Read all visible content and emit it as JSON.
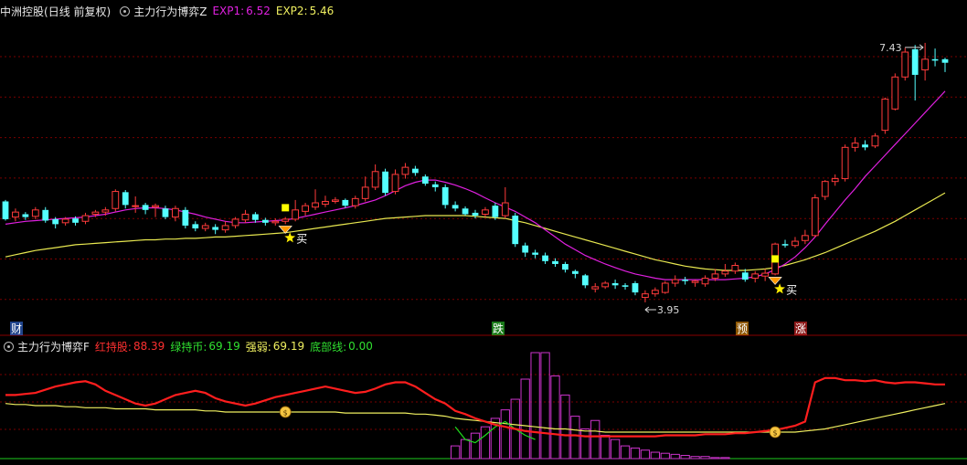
{
  "main_header": {
    "stock": "中洲控股",
    "period": "(日线 前复权)",
    "indicator": "主力行为博弈Z",
    "exp1_label": "EXP1:",
    "exp1_value": "6.52",
    "exp2_label": "EXP2:",
    "exp2_value": "5.46"
  },
  "sub_header": {
    "indicator": "主力行为博弈F",
    "hongchi_label": "红持股:",
    "hongchi_value": "88.39",
    "lvchi_label": "绿持币:",
    "lvchi_value": "69.19",
    "qiangruo_label": "强弱:",
    "qiangruo_value": "69.19",
    "dibu_label": "底部线:",
    "dibu_value": "0.00"
  },
  "colors": {
    "up": "#ff3b3b",
    "down": "#54ffff",
    "ma_fast": "#e020e0",
    "ma_slow": "#e8e850",
    "grid": "#7a0000",
    "hold": "#ff1e1e",
    "cash": "#1edc1e",
    "strength": "#f0f060",
    "bar": "#cc33cc"
  },
  "chart_data": [
    {
      "type": "candlestick",
      "ylim": [
        3.6,
        7.75
      ],
      "grid": true,
      "candles": [
        [
          5.2,
          4.95,
          5.22,
          4.93
        ],
        [
          4.98,
          5.05,
          5.1,
          4.92
        ],
        [
          5.02,
          4.98,
          5.05,
          4.94
        ],
        [
          4.99,
          5.08,
          5.12,
          4.95
        ],
        [
          5.08,
          4.93,
          5.12,
          4.9
        ],
        [
          4.95,
          4.88,
          4.98,
          4.82
        ],
        [
          4.9,
          4.95,
          4.98,
          4.86
        ],
        [
          4.96,
          4.9,
          4.99,
          4.86
        ],
        [
          4.92,
          5.0,
          5.04,
          4.88
        ],
        [
          5.02,
          5.05,
          5.08,
          4.98
        ],
        [
          5.05,
          5.08,
          5.12,
          5.0
        ],
        [
          5.1,
          5.34,
          5.37,
          5.06
        ],
        [
          5.33,
          5.15,
          5.36,
          5.1
        ],
        [
          5.14,
          5.14,
          5.27,
          5.04
        ],
        [
          5.15,
          5.08,
          5.18,
          5.02
        ],
        [
          5.12,
          5.14,
          5.17,
          4.98
        ],
        [
          5.1,
          4.98,
          5.14,
          4.95
        ],
        [
          4.98,
          5.1,
          5.14,
          4.92
        ],
        [
          5.08,
          4.86,
          5.12,
          4.82
        ],
        [
          4.88,
          4.82,
          4.92,
          4.78
        ],
        [
          4.82,
          4.86,
          4.9,
          4.78
        ],
        [
          4.84,
          4.8,
          4.88,
          4.74
        ],
        [
          4.8,
          4.86,
          4.92,
          4.76
        ],
        [
          4.86,
          4.95,
          4.98,
          4.82
        ],
        [
          4.94,
          5.02,
          5.08,
          4.9
        ],
        [
          5.02,
          4.94,
          5.05,
          4.9
        ],
        [
          4.94,
          4.9,
          4.97,
          4.86
        ],
        [
          4.9,
          4.92,
          4.96,
          4.86
        ],
        [
          4.92,
          4.95,
          4.98,
          4.88
        ],
        [
          4.95,
          5.08,
          5.22,
          4.92
        ],
        [
          5.06,
          5.14,
          5.18,
          5.0
        ],
        [
          5.12,
          5.18,
          5.37,
          5.08
        ],
        [
          5.16,
          5.2,
          5.28,
          5.12
        ],
        [
          5.2,
          5.22,
          5.26,
          5.17
        ],
        [
          5.22,
          5.14,
          5.24,
          5.11
        ],
        [
          5.14,
          5.24,
          5.28,
          5.1
        ],
        [
          5.24,
          5.4,
          5.55,
          5.2
        ],
        [
          5.4,
          5.62,
          5.72,
          5.36
        ],
        [
          5.62,
          5.32,
          5.66,
          5.28
        ],
        [
          5.34,
          5.58,
          5.65,
          5.3
        ],
        [
          5.58,
          5.68,
          5.74,
          5.52
        ],
        [
          5.66,
          5.6,
          5.7,
          5.56
        ],
        [
          5.55,
          5.45,
          5.58,
          5.42
        ],
        [
          5.44,
          5.4,
          5.48,
          5.34
        ],
        [
          5.4,
          5.15,
          5.44,
          5.1
        ],
        [
          5.15,
          5.1,
          5.2,
          5.06
        ],
        [
          5.1,
          5.02,
          5.13,
          5.0
        ],
        [
          5.04,
          5.0,
          5.08,
          4.96
        ],
        [
          5.02,
          5.08,
          5.12,
          4.98
        ],
        [
          5.14,
          4.98,
          5.18,
          4.94
        ],
        [
          5.0,
          5.18,
          5.4,
          4.96
        ],
        [
          5.0,
          4.6,
          5.04,
          4.56
        ],
        [
          4.58,
          4.48,
          4.62,
          4.42
        ],
        [
          4.48,
          4.45,
          4.52,
          4.4
        ],
        [
          4.44,
          4.36,
          4.48,
          4.32
        ],
        [
          4.36,
          4.32,
          4.4,
          4.28
        ],
        [
          4.32,
          4.24,
          4.35,
          4.2
        ],
        [
          4.22,
          4.18,
          4.24,
          4.12
        ],
        [
          4.16,
          4.02,
          4.18,
          3.98
        ],
        [
          3.97,
          4.0,
          4.05,
          3.92
        ],
        [
          4.0,
          4.05,
          4.08,
          3.97
        ],
        [
          4.05,
          4.02,
          4.1,
          3.97
        ],
        [
          4.02,
          4.0,
          4.05,
          3.96
        ],
        [
          4.05,
          3.92,
          4.08,
          3.88
        ],
        [
          3.85,
          3.9,
          3.95,
          3.78
        ],
        [
          3.9,
          3.95,
          3.99,
          3.86
        ],
        [
          3.92,
          4.05,
          4.08,
          3.9
        ],
        [
          4.05,
          4.1,
          4.16,
          4.0
        ],
        [
          4.1,
          4.08,
          4.14,
          4.03
        ],
        [
          4.06,
          4.08,
          4.1,
          4.0
        ],
        [
          4.04,
          4.12,
          4.16,
          4.0
        ],
        [
          4.12,
          4.18,
          4.25,
          4.08
        ],
        [
          4.18,
          4.22,
          4.32,
          4.14
        ],
        [
          4.22,
          4.3,
          4.34,
          4.18
        ],
        [
          4.2,
          4.1,
          4.25,
          4.07
        ],
        [
          4.12,
          4.18,
          4.22,
          4.06
        ],
        [
          4.15,
          4.19,
          4.25,
          4.08
        ],
        [
          4.18,
          4.6,
          4.62,
          4.16
        ],
        [
          4.6,
          4.58,
          4.66,
          4.55
        ],
        [
          4.58,
          4.64,
          4.7,
          4.55
        ],
        [
          4.65,
          4.72,
          4.8,
          4.6
        ],
        [
          4.72,
          5.25,
          5.3,
          4.7
        ],
        [
          5.27,
          5.48,
          5.5,
          5.22
        ],
        [
          5.48,
          5.52,
          5.58,
          5.42
        ],
        [
          5.52,
          5.96,
          6.0,
          5.48
        ],
        [
          5.96,
          6.02,
          6.1,
          5.9
        ],
        [
          6.0,
          5.96,
          6.06,
          5.92
        ],
        [
          5.98,
          6.12,
          6.16,
          5.95
        ],
        [
          6.2,
          6.64,
          6.66,
          6.15
        ],
        [
          6.5,
          6.95,
          7.0,
          6.48
        ],
        [
          6.95,
          7.3,
          7.36,
          6.9
        ],
        [
          7.34,
          6.98,
          7.4,
          6.62
        ],
        [
          7.05,
          7.2,
          7.43,
          6.9
        ],
        [
          7.2,
          7.18,
          7.35,
          7.1
        ],
        [
          7.2,
          7.15,
          7.22,
          7.02
        ]
      ],
      "ma_fast": [
        4.88,
        4.9,
        4.92,
        4.93,
        4.94,
        4.95,
        4.96,
        4.97,
        4.98,
        5.0,
        5.02,
        5.05,
        5.08,
        5.1,
        5.11,
        5.11,
        5.1,
        5.08,
        5.05,
        5.02,
        4.98,
        4.95,
        4.92,
        4.9,
        4.9,
        4.91,
        4.92,
        4.93,
        4.94,
        4.96,
        4.99,
        5.02,
        5.05,
        5.08,
        5.11,
        5.14,
        5.18,
        5.22,
        5.28,
        5.35,
        5.42,
        5.47,
        5.5,
        5.5,
        5.47,
        5.43,
        5.38,
        5.32,
        5.25,
        5.18,
        5.12,
        5.06,
        4.98,
        4.9,
        4.8,
        4.7,
        4.6,
        4.52,
        4.44,
        4.38,
        4.32,
        4.27,
        4.22,
        4.18,
        4.15,
        4.12,
        4.1,
        4.1,
        4.1,
        4.1,
        4.1,
        4.1,
        4.1,
        4.11,
        4.12,
        4.14,
        4.18,
        4.24,
        4.32,
        4.42,
        4.55,
        4.7,
        4.88,
        5.05,
        5.22,
        5.38,
        5.55,
        5.7,
        5.85,
        6.0,
        6.15,
        6.3,
        6.45,
        6.6,
        6.75
      ],
      "ma_slow": [
        4.42,
        4.45,
        4.48,
        4.51,
        4.53,
        4.55,
        4.57,
        4.59,
        4.6,
        4.61,
        4.62,
        4.63,
        4.64,
        4.65,
        4.66,
        4.66,
        4.67,
        4.67,
        4.68,
        4.68,
        4.69,
        4.7,
        4.7,
        4.71,
        4.72,
        4.73,
        4.74,
        4.75,
        4.76,
        4.78,
        4.8,
        4.82,
        4.84,
        4.86,
        4.88,
        4.9,
        4.92,
        4.94,
        4.96,
        4.97,
        4.98,
        4.99,
        5.0,
        5.0,
        5.0,
        5.0,
        5.0,
        4.99,
        4.98,
        4.97,
        4.96,
        4.93,
        4.9,
        4.86,
        4.82,
        4.78,
        4.74,
        4.7,
        4.66,
        4.62,
        4.58,
        4.54,
        4.5,
        4.46,
        4.42,
        4.38,
        4.35,
        4.32,
        4.29,
        4.27,
        4.25,
        4.24,
        4.23,
        4.23,
        4.23,
        4.24,
        4.25,
        4.27,
        4.3,
        4.34,
        4.38,
        4.43,
        4.48,
        4.54,
        4.6,
        4.66,
        4.72,
        4.78,
        4.85,
        4.92,
        5.0,
        5.08,
        5.16,
        5.24,
        5.32
      ],
      "annotations": {
        "high_label": "7.43",
        "low_label": "3.95",
        "buy_text": "买",
        "bottom_markers": [
          "财",
          "跌",
          "预",
          "涨"
        ]
      }
    },
    {
      "type": "line+bar",
      "ylim": [
        0,
        100
      ],
      "hold_line": [
        60,
        60,
        61,
        62,
        65,
        68,
        70,
        72,
        73,
        70,
        64,
        60,
        56,
        52,
        50,
        52,
        56,
        60,
        62,
        64,
        62,
        57,
        54,
        52,
        50,
        52,
        55,
        58,
        60,
        62,
        64,
        66,
        68,
        66,
        64,
        62,
        63,
        66,
        70,
        72,
        72,
        68,
        62,
        56,
        52,
        45,
        42,
        38,
        35,
        32,
        30,
        28,
        26,
        25,
        24,
        23,
        22,
        22,
        21,
        21,
        21,
        21,
        21,
        21,
        21,
        21,
        22,
        22,
        22,
        22,
        23,
        23,
        23,
        24,
        24,
        25,
        26,
        27,
        29,
        31,
        35,
        72,
        76,
        76,
        74,
        74,
        73,
        74,
        72,
        71,
        72,
        72,
        71,
        70,
        70
      ],
      "cash_line": [
        null,
        null,
        null,
        null,
        null,
        null,
        null,
        null,
        null,
        null,
        null,
        null,
        null,
        null,
        null,
        null,
        null,
        null,
        null,
        null,
        null,
        null,
        null,
        null,
        null,
        null,
        null,
        null,
        null,
        null,
        null,
        null,
        null,
        null,
        null,
        null,
        null,
        null,
        null,
        null,
        null,
        null,
        null,
        null,
        null,
        30,
        18,
        15,
        22,
        30,
        35,
        28,
        22,
        18,
        null,
        null,
        null,
        null,
        null,
        null,
        null,
        null,
        null,
        null,
        null,
        null,
        null,
        null,
        null,
        null,
        null,
        null,
        null,
        null,
        null,
        null,
        null,
        null,
        null,
        null,
        null,
        null,
        null,
        null,
        null,
        null,
        null,
        null,
        null,
        null,
        null,
        null,
        null,
        null,
        null
      ],
      "strength_line": [
        52,
        51,
        51,
        50,
        50,
        50,
        49,
        49,
        48,
        48,
        48,
        47,
        47,
        47,
        47,
        46,
        46,
        46,
        46,
        46,
        45,
        45,
        44,
        44,
        44,
        44,
        44,
        44,
        44,
        44,
        44,
        44,
        44,
        44,
        43,
        43,
        43,
        43,
        43,
        43,
        43,
        42,
        42,
        41,
        40,
        38,
        37,
        36,
        35,
        34,
        33,
        32,
        31,
        30,
        29,
        28,
        28,
        27,
        26,
        26,
        25,
        25,
        25,
        25,
        25,
        25,
        25,
        25,
        25,
        25,
        25,
        25,
        25,
        25,
        25,
        25,
        25,
        25,
        25,
        25,
        26,
        27,
        28,
        30,
        32,
        34,
        36,
        38,
        40,
        42,
        44,
        46,
        48,
        50,
        52
      ],
      "bars": [
        0,
        0,
        0,
        0,
        0,
        0,
        0,
        0,
        0,
        0,
        0,
        0,
        0,
        0,
        0,
        0,
        0,
        0,
        0,
        0,
        0,
        0,
        0,
        0,
        0,
        0,
        0,
        0,
        0,
        0,
        0,
        0,
        0,
        0,
        0,
        0,
        0,
        0,
        0,
        0,
        0,
        0,
        0,
        0,
        0,
        12,
        18,
        24,
        30,
        38,
        46,
        56,
        75,
        100,
        100,
        78,
        60,
        40,
        28,
        36,
        22,
        18,
        12,
        10,
        8,
        6,
        5,
        4,
        3,
        2,
        2,
        1,
        1,
        0,
        0,
        0,
        0,
        0,
        0,
        0,
        0,
        0,
        0,
        0,
        0,
        0,
        0,
        0,
        0,
        0,
        0,
        0,
        0,
        0,
        0
      ]
    }
  ]
}
